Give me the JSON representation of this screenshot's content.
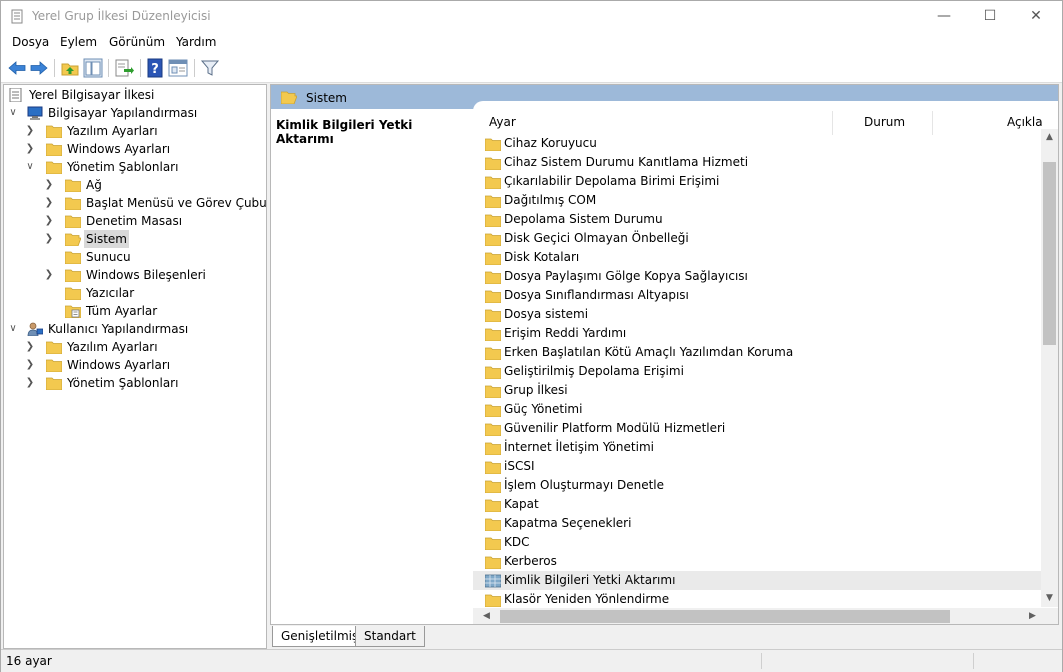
{
  "window": {
    "title": "Yerel Grup İlkesi Düzenleyicisi"
  },
  "menu": [
    "Dosya",
    "Eylem",
    "Görünüm",
    "Yardım"
  ],
  "tree": {
    "root": "Yerel Bilgisayar İlkesi",
    "computer": "Bilgisayar Yapılandırması",
    "software": "Yazılım Ayarları",
    "windows": "Windows Ayarları",
    "admin": "Yönetim Şablonları",
    "ag": "Ağ",
    "start": "Başlat Menüsü ve Görev Çubuğu",
    "control": "Denetim Masası",
    "sistem": "Sistem",
    "sunucu": "Sunucu",
    "wincomp": "Windows Bileşenleri",
    "printers": "Yazıcılar",
    "all": "Tüm Ayarlar",
    "user": "Kullanıcı Yapılandırması",
    "u_software": "Yazılım Ayarları",
    "u_windows": "Windows Ayarları",
    "u_admin": "Yönetim Şablonları"
  },
  "header": {
    "title": "Sistem"
  },
  "description": {
    "title": "Kimlik Bilgileri Yetki Aktarımı"
  },
  "columns": {
    "setting": "Ayar",
    "state": "Durum",
    "comment": "Açıkla"
  },
  "items": [
    "Cihaz Koruyucu",
    "Cihaz Sistem Durumu Kanıtlama Hizmeti",
    "Çıkarılabilir Depolama Birimi Erişimi",
    "Dağıtılmış COM",
    "Depolama Sistem Durumu",
    "Disk Geçici Olmayan Önbelleği",
    "Disk Kotaları",
    "Dosya Paylaşımı Gölge Kopya Sağlayıcısı",
    "Dosya Sınıflandırması Altyapısı",
    "Dosya sistemi",
    "Erişim Reddi Yardımı",
    "Erken Başlatılan Kötü Amaçlı Yazılımdan Koruma",
    "Geliştirilmiş Depolama Erişimi",
    "Grup İlkesi",
    "Güç Yönetimi",
    "Güvenilir Platform Modülü Hizmetleri",
    "İnternet İletişim Yönetimi",
    "iSCSI",
    "İşlem Oluşturmayı Denetle",
    "Kapat",
    "Kapatma Seçenekleri",
    "KDC",
    "Kerberos",
    "Kimlik Bilgileri Yetki Aktarımı",
    "Klasör Yeniden Yönlendirme"
  ],
  "tabs": [
    "Genişletilmiş",
    "Standart"
  ],
  "status": {
    "text": "16 ayar"
  },
  "colors": {
    "header_band": "#9db9d9",
    "folder": "#f3c94f",
    "selection": "#d9d9d9"
  }
}
